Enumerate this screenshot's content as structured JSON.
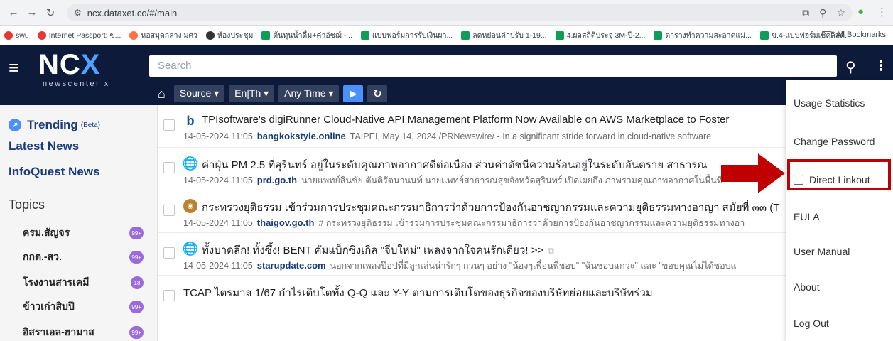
{
  "browser": {
    "url": "ncx.dataxet.co/#/main",
    "bookmarks": [
      {
        "label": "swu",
        "color": "red"
      },
      {
        "label": "Internet Passport: ข...",
        "color": "red"
      },
      {
        "label": "หอสมุดกลาง มศว",
        "color": "orange"
      },
      {
        "label": "ห้องประชุม",
        "color": "dark"
      },
      {
        "label": "ต้นทุนน้ำดื่ม+ค่าอัชฌ์ -...",
        "color": "green"
      },
      {
        "label": "แบบฟอร์มการรับเงินผา...",
        "color": "green"
      },
      {
        "label": "ลดหย่อนค่าปรับ 1-19...",
        "color": "green"
      },
      {
        "label": "4.ผลสถิติประจุ 3M-ปี-2...",
        "color": "green"
      },
      {
        "label": "ตารางทำความสะอาดแม่...",
        "color": "green"
      },
      {
        "label": "ข.4-แบบฟอร์มเช็คลิสต์...",
        "color": "green"
      }
    ],
    "more_bookmarks": "»",
    "all_bookmarks": "All Bookmarks"
  },
  "app": {
    "logo_main": "NC",
    "logo_x": "X",
    "logo_sub": "newscenter x",
    "search_placeholder": "Search",
    "toolbar": {
      "source": "Source ▾",
      "lang": "En|Th ▾",
      "time": "Any Time ▾"
    }
  },
  "sidebar": {
    "trending": "Trending",
    "beta": "(Beta)",
    "latest": "Latest News",
    "infoquest": "InfoQuest News",
    "topics_title": "Topics",
    "topics": [
      {
        "label": "ครม.สัญจร",
        "count": "99+"
      },
      {
        "label": "กกต.-สว.",
        "count": "99+"
      },
      {
        "label": "โรงงานสารเคมี",
        "count": "18"
      },
      {
        "label": "ข้าวเก่าสิบปี",
        "count": "99+"
      },
      {
        "label": "อิสราเอล-ฮามาส",
        "count": "99+"
      }
    ]
  },
  "news": [
    {
      "headline": "TPIsoftware's digiRunner Cloud-Native API Management Platform Now Available on AWS Marketplace to Foster",
      "date": "14-05-2024 11:05",
      "site": "bangkokstyle.online",
      "snippet": "TAIPEI, May 14, 2024 /PRNewswire/ - In a significant stride forward in cloud-native software"
    },
    {
      "headline": "ค่าฝุ่น PM 2.5 ที่สุรินทร์ อยู่ในระดับคุณภาพอากาศดีต่อเนื่อง ส่วนค่าดัชนีความร้อนอยู่ในระดับอันตราย สาธารณ",
      "date": "14-05-2024 11:05",
      "site": "prd.go.th",
      "snippet": "นายแพทย์สินชัย ตันติรัตนานนท์ นายแพทย์สาธารณสุขจังหวัดสุรินทร์ เปิดเผยถึง ภาพรวมคุณภาพอากาศในพื้นที่"
    },
    {
      "headline": "กระทรวงยุติธรรม เข้าร่วมการประชุมคณะกรรมาธิการว่าด้วยการป้องกันอาชญากรรมและความยุติธรรมทางอาญา สมัยที่ ๓๓ (T",
      "date": "14-05-2024 11:05",
      "site": "thaigov.go.th",
      "snippet": "# กระทรวงยุติธรรม เข้าร่วมการประชุมคณะกรรมาธิการว่าด้วยการป้องกันอาชญากรรมและความยุติธรรมทางอา"
    },
    {
      "headline": "ทั้งบาดลึก! ทั้งซึ้ง! BENT คัมแบ็กซิงเกิล \"จีบใหม่\" เพลงจากใจคนรักเดียว! >>",
      "date": "14-05-2024 11:05",
      "site": "starupdate.com",
      "snippet": "นอกจากเพลงป๊อปที่มีลูกเล่นน่ารักๆ กวนๆ อย่าง \"น้องๆเพื่อนพี่ชอบ\" \"ฉันชอบแกว่ะ\" และ \"ขอบคุณไม่ได้ชอบแ"
    },
    {
      "headline": "TCAP ไตรมาส 1/67 กำไรเติบโตทั้ง Q-Q และ Y-Y ตามการเติบโตของธุรกิจของบริษัทย่อยและบริษัทร่วม"
    }
  ],
  "menu": {
    "items": [
      "Usage Statistics",
      "Change Password",
      "Direct Linkout",
      "EULA",
      "User Manual",
      "About",
      "Log Out"
    ]
  },
  "colors": {
    "header_bg": "#0e1a3a",
    "accent": "#4a90ff",
    "highlight": "#c00000",
    "badge": "#9b6bd9"
  }
}
